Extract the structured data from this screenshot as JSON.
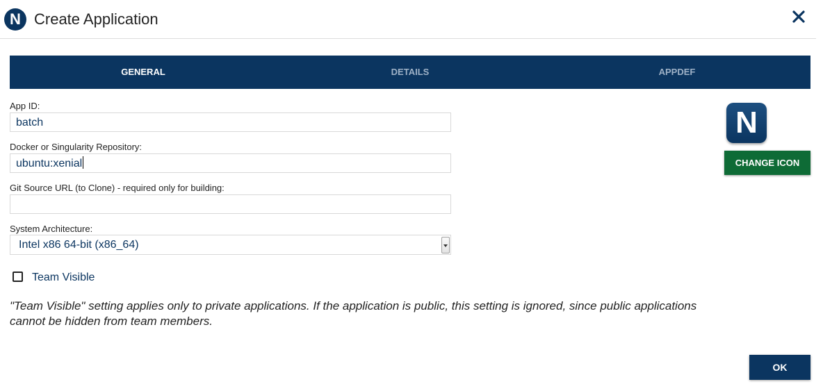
{
  "header": {
    "logo_letter": "N",
    "title": "Create Application",
    "close_icon": "close-icon"
  },
  "tabs": [
    {
      "label": "GENERAL",
      "active": true
    },
    {
      "label": "DETAILS",
      "active": false
    },
    {
      "label": "APPDEF",
      "active": false
    }
  ],
  "form": {
    "app_id": {
      "label": "App ID:",
      "value": "batch"
    },
    "repository": {
      "label": "Docker or Singularity Repository:",
      "value": "ubuntu:xenial"
    },
    "git_source": {
      "label": "Git Source URL (to Clone) - required only for building:",
      "value": ""
    },
    "architecture": {
      "label": "System Architecture:",
      "selected": "Intel x86 64-bit (x86_64)"
    },
    "team_visible": {
      "label": "Team Visible",
      "checked": false
    },
    "note": "\"Team Visible\" setting applies only to private applications. If the application is public, this setting is ignored, since public applications cannot be hidden from team members."
  },
  "icon_panel": {
    "icon_letter": "N",
    "change_icon_label": "CHANGE ICON"
  },
  "footer": {
    "ok_label": "OK"
  },
  "colors": {
    "navy": "#0b3560",
    "green": "#0e6b36",
    "inactive_tab": "#9fb2c7"
  }
}
